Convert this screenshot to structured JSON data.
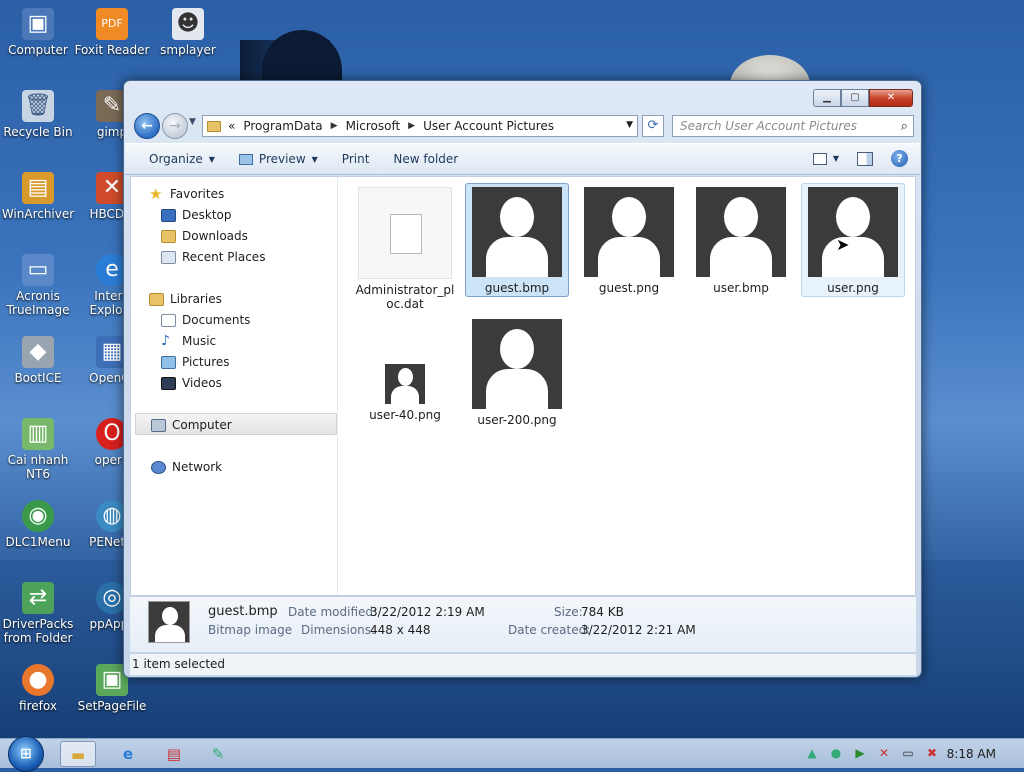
{
  "desktop": {
    "icons": [
      {
        "label": "Computer"
      },
      {
        "label": "Foxit Reader"
      },
      {
        "label": "smplayer"
      },
      {
        "label": "Recycle Bin"
      },
      {
        "label": "gimp"
      },
      {
        "label": "WinArchiver"
      },
      {
        "label": "HBCDM"
      },
      {
        "label": "Acronis TrueImage"
      },
      {
        "label": "Intern Explore"
      },
      {
        "label": "BootICE"
      },
      {
        "label": "OpenOf"
      },
      {
        "label": "Cai nhanh NT6"
      },
      {
        "label": "opera"
      },
      {
        "label": "DLC1Menu"
      },
      {
        "label": "PENetw"
      },
      {
        "label": "DriverPacks from Folder"
      },
      {
        "label": "ppApps"
      },
      {
        "label": "firefox"
      },
      {
        "label": "SetPageFile"
      }
    ]
  },
  "window": {
    "address": {
      "overflow": "«",
      "crumbs": [
        "ProgramData",
        "Microsoft",
        "User Account Pictures"
      ]
    },
    "search": {
      "placeholder": "Search User Account Pictures"
    },
    "toolbar": {
      "organize": "Organize",
      "preview": "Preview",
      "print": "Print",
      "new_folder": "New folder"
    },
    "nav": {
      "favorites": "Favorites",
      "desktop": "Desktop",
      "downloads": "Downloads",
      "recent": "Recent Places",
      "libraries": "Libraries",
      "documents": "Documents",
      "music": "Music",
      "pictures": "Pictures",
      "videos": "Videos",
      "computer": "Computer",
      "network": "Network"
    },
    "files": [
      {
        "name": "Administrator_pl oc.dat"
      },
      {
        "name": "guest.bmp"
      },
      {
        "name": "guest.png"
      },
      {
        "name": "user.bmp"
      },
      {
        "name": "user.png"
      },
      {
        "name": "user-40.png"
      },
      {
        "name": "user-200.png"
      }
    ],
    "details": {
      "name": "guest.bmp",
      "type": "Bitmap image",
      "modified_label": "Date modified:",
      "modified": "3/22/2012 2:19 AM",
      "dimensions_label": "Dimensions:",
      "dimensions": "448 x 448",
      "size_label": "Size:",
      "size": "784 KB",
      "created_label": "Date created:",
      "created": "3/22/2012 2:21 AM"
    },
    "status": "1 item selected"
  },
  "taskbar": {
    "clock": "8:18 AM"
  },
  "colors": {
    "selection": "#cce4f7",
    "accent": "#1e395b"
  }
}
